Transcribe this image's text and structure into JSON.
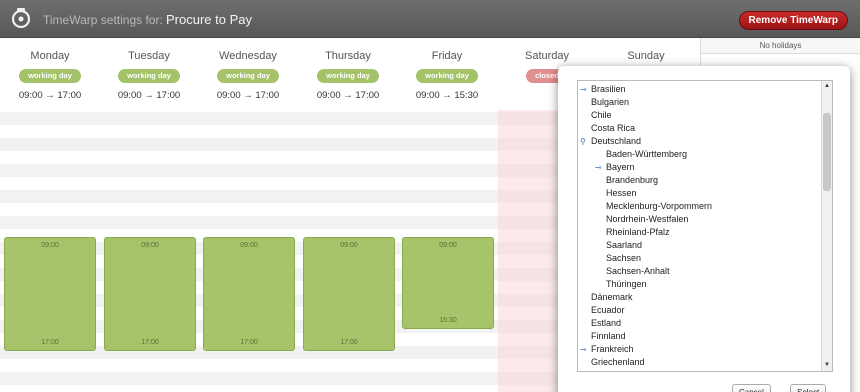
{
  "header": {
    "prefix": "TimeWarp settings for:",
    "title": "Procure to Pay",
    "remove_label": "Remove TimeWarp"
  },
  "days": [
    {
      "name": "Monday",
      "status": "working day",
      "hours": "09:00 → 17:00",
      "start": "09:00",
      "end": "17:00"
    },
    {
      "name": "Tuesday",
      "status": "working day",
      "hours": "09:00 → 17:00",
      "start": "09:00",
      "end": "17:00"
    },
    {
      "name": "Wednesday",
      "status": "working day",
      "hours": "09:00 → 17:00",
      "start": "09:00",
      "end": "17:00"
    },
    {
      "name": "Thursday",
      "status": "working day",
      "hours": "09:00 → 17:00",
      "start": "09:00",
      "end": "17:00"
    },
    {
      "name": "Friday",
      "status": "working day",
      "hours": "09:00 → 15:30",
      "start": "09:00",
      "end": "15:30"
    },
    {
      "name": "Saturday",
      "status": "closed"
    },
    {
      "name": "Sunday"
    }
  ],
  "holidays_panel": {
    "empty_text": "No holidays"
  },
  "country_list": {
    "items": [
      {
        "label": "Brasilien",
        "level": 0,
        "toggle": "⊸"
      },
      {
        "label": "Bulgarien",
        "level": 0
      },
      {
        "label": "Chile",
        "level": 0
      },
      {
        "label": "Costa Rica",
        "level": 0
      },
      {
        "label": "Deutschland",
        "level": 0,
        "toggle": "⚲"
      },
      {
        "label": "Baden-Württemberg",
        "level": 1
      },
      {
        "label": "Bayern",
        "level": 1,
        "toggle": "⊸"
      },
      {
        "label": "Brandenburg",
        "level": 1
      },
      {
        "label": "Hessen",
        "level": 1
      },
      {
        "label": "Mecklenburg-Vorpommern",
        "level": 1
      },
      {
        "label": "Nordrhein-Westfalen",
        "level": 1
      },
      {
        "label": "Rheinland-Pfalz",
        "level": 1
      },
      {
        "label": "Saarland",
        "level": 1
      },
      {
        "label": "Sachsen",
        "level": 1
      },
      {
        "label": "Sachsen-Anhalt",
        "level": 1
      },
      {
        "label": "Thüringen",
        "level": 1
      },
      {
        "label": "Dänemark",
        "level": 0
      },
      {
        "label": "Ecuador",
        "level": 0
      },
      {
        "label": "Estland",
        "level": 0
      },
      {
        "label": "Finnland",
        "level": 0
      },
      {
        "label": "Frankreich",
        "level": 0,
        "toggle": "⊸"
      },
      {
        "label": "Griechenland",
        "level": 0
      }
    ]
  },
  "popup": {
    "cancel_label": "Cancel",
    "select_label": "Select"
  },
  "icons": {
    "logo": "timewarp-clock-icon",
    "expand": "expand-toggle-icon"
  },
  "colors": {
    "working": "#a3c26a",
    "closed": "#e0908e",
    "remove": "#b81f1f"
  }
}
